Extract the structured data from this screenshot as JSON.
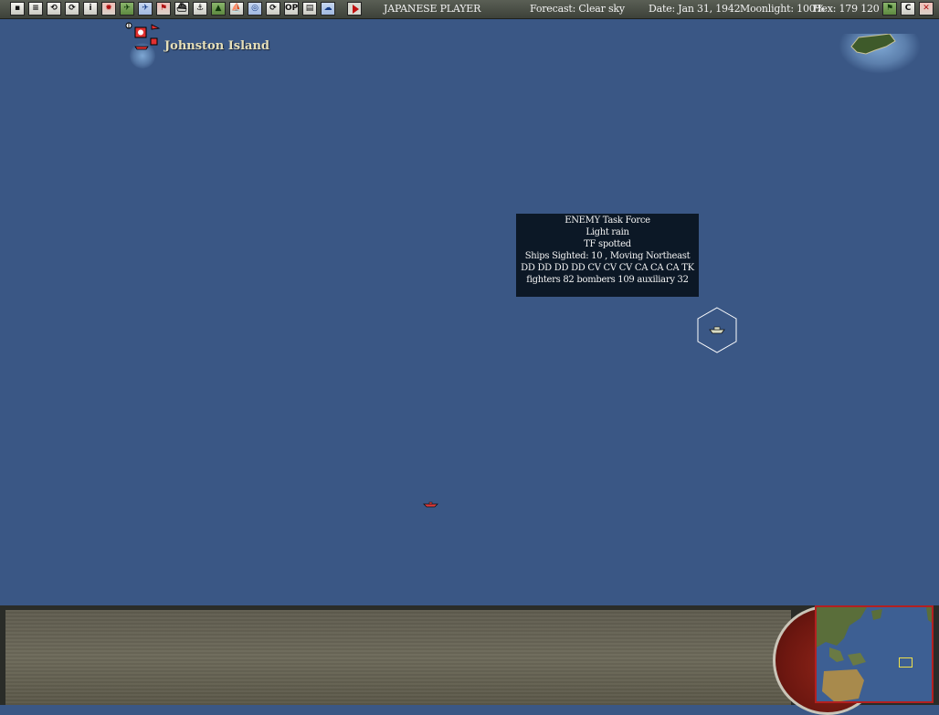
{
  "toolbar": {
    "player": "JAPANESE PLAYER",
    "forecast": "Forecast: Clear sky",
    "date": "Date: Jan 31, 1942",
    "moonlight": "Moonlight: 100%",
    "hex": "Hex: 179 120",
    "buttons": [
      {
        "name": "save-icon",
        "glyph": "▪"
      },
      {
        "name": "report-icon",
        "glyph": "≡"
      },
      {
        "name": "cycle-icon",
        "glyph": "⟲"
      },
      {
        "name": "cycle-icon",
        "glyph": "⟳"
      },
      {
        "name": "info-icon",
        "glyph": "i"
      },
      {
        "name": "rising-sun-flag-icon",
        "glyph": "✹"
      },
      {
        "name": "aircraft-icon",
        "glyph": "✈"
      },
      {
        "name": "aircraft-group-icon",
        "glyph": "✈"
      },
      {
        "name": "flag-icon",
        "glyph": "⚑"
      },
      {
        "name": "ship-icon",
        "glyph": "⛴"
      },
      {
        "name": "route-icon",
        "glyph": "⚓"
      },
      {
        "name": "land-unit-icon",
        "glyph": "▲"
      },
      {
        "name": "convoy-icon",
        "glyph": "⛵"
      },
      {
        "name": "globe-icon",
        "glyph": "◎"
      },
      {
        "name": "refresh-icon",
        "glyph": "⟳"
      },
      {
        "name": "operations-icon",
        "glyph": "OP"
      },
      {
        "name": "database-icon",
        "glyph": "▤"
      },
      {
        "name": "weather-icon",
        "glyph": "☁"
      }
    ],
    "right_buttons": [
      {
        "name": "flag-marker-icon",
        "glyph": "⚑"
      },
      {
        "name": "c-button-icon",
        "glyph": "C"
      },
      {
        "name": "close-icon",
        "glyph": "✕"
      }
    ]
  },
  "map": {
    "island_label": "Johnston Island"
  },
  "tooltip": {
    "line1": "ENEMY Task Force",
    "line2": "Light rain",
    "line3": "TF spotted",
    "line4": "Ships Sighted: 10 , Moving Northeast",
    "line5": "DD DD DD DD CV CV CV CA CA CA TK",
    "line6": "fighters 82  bombers 109  auxiliary 32"
  },
  "colors": {
    "ocean": "#3a5785",
    "tooltip_bg": "#0c1826",
    "label": "#e6dfb8"
  }
}
